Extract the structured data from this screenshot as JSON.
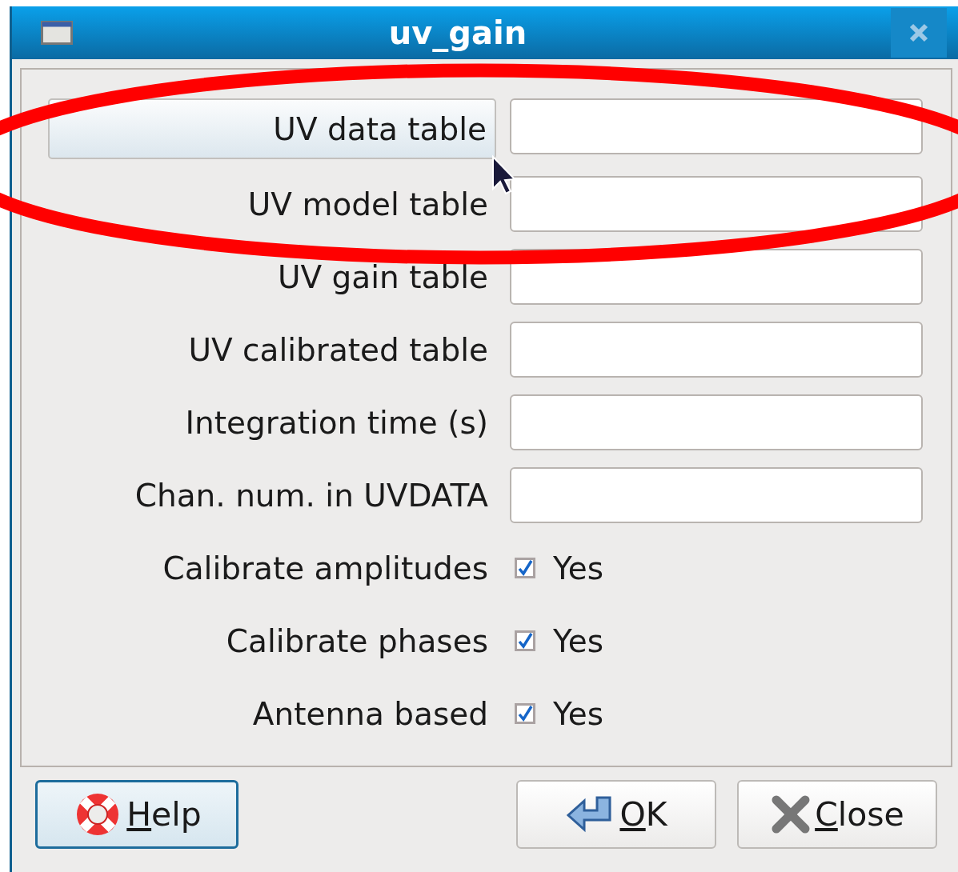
{
  "window": {
    "title": "uv_gain"
  },
  "rows": [
    {
      "kind": "button-field",
      "label": "UV data table",
      "value": ""
    },
    {
      "kind": "field",
      "label": "UV model table",
      "value": ""
    },
    {
      "kind": "field",
      "label": "UV gain table",
      "value": ""
    },
    {
      "kind": "field",
      "label": "UV calibrated table",
      "value": ""
    },
    {
      "kind": "field",
      "label": "Integration time (s)",
      "value": ""
    },
    {
      "kind": "field",
      "label": "Chan. num. in UVDATA",
      "value": ""
    },
    {
      "kind": "checkbox",
      "label": "Calibrate amplitudes",
      "checked": true,
      "option": "Yes"
    },
    {
      "kind": "checkbox",
      "label": "Calibrate phases",
      "checked": true,
      "option": "Yes"
    },
    {
      "kind": "checkbox",
      "label": "Antenna based",
      "checked": true,
      "option": "Yes"
    }
  ],
  "buttons": [
    {
      "kind": "help",
      "access_key": "H",
      "label_rest": "elp",
      "focused": true
    },
    {
      "kind": "ok",
      "access_key": "O",
      "label_rest": "K",
      "focused": false
    },
    {
      "kind": "close",
      "access_key": "C",
      "label_rest": "lose",
      "focused": false
    }
  ]
}
